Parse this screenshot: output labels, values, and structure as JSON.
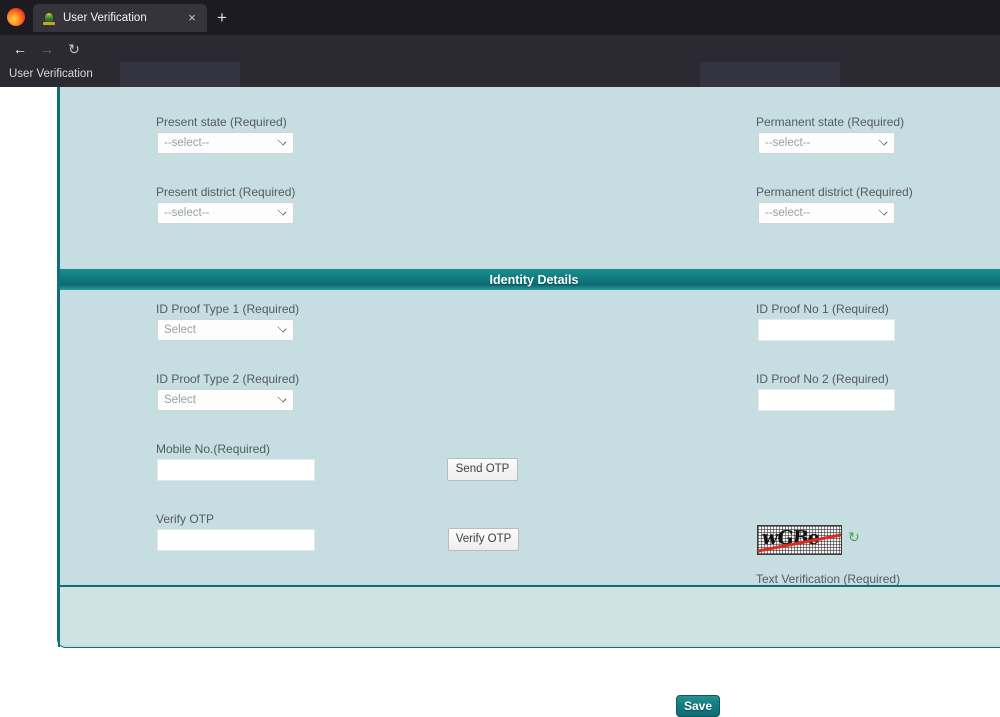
{
  "browser": {
    "tab": {
      "title": "User Verification",
      "favicon": "goa-police-emblem-icon",
      "close_label": "×"
    },
    "new_tab_label": "+",
    "nav": {
      "back": "←",
      "forward": "→",
      "reload": "↻"
    },
    "url": "https://citizen.goapolice.gov.in/web/guest/?p_p_id=58&p_p_lifecycle=0&p_p_state=maximized&p_p_mode=view&p_p_col_id=column-1&p_p_col_count=1&saveLastP",
    "status_tooltip": "User Verification"
  },
  "form": {
    "address_section": {
      "fields": [
        {
          "label": "Present state (Required)",
          "value": "--select--"
        },
        {
          "label": "Permanent state (Required)",
          "value": "--select--"
        },
        {
          "label": "Present district (Required)",
          "value": "--select--"
        },
        {
          "label": "Permanent district (Required)",
          "value": "--select--"
        }
      ]
    },
    "identity_section": {
      "title": "Identity Details",
      "id_proof_type_1": {
        "label": "ID Proof Type 1 (Required)",
        "value": "Select"
      },
      "id_proof_no_1": {
        "label": "ID Proof No 1 (Required)",
        "value": ""
      },
      "id_proof_type_2": {
        "label": "ID Proof Type 2 (Required)",
        "value": "Select"
      },
      "id_proof_no_2": {
        "label": "ID Proof No 2 (Required)",
        "value": ""
      },
      "mobile": {
        "label": "Mobile No.(Required)",
        "value": ""
      },
      "send_otp": {
        "label": "Send OTP"
      },
      "verify_otp_field": {
        "label": "Verify OTP",
        "value": ""
      },
      "verify_otp_button": {
        "label": "Verify OTP"
      },
      "captcha": {
        "glyphs": "wGBe",
        "refresh_icon": "↻",
        "text_verification_label": "Text Verification (Required)",
        "text_verification_value": ""
      }
    },
    "save_button": {
      "label": "Save"
    }
  },
  "colors": {
    "panel_background": "#c6dde2",
    "panel_border": "#0d7078",
    "section_header": "#0f7b7f",
    "save_button": "#167e84",
    "captcha_strike": "#e02b20",
    "refresh_icon": "#4aa64a"
  }
}
